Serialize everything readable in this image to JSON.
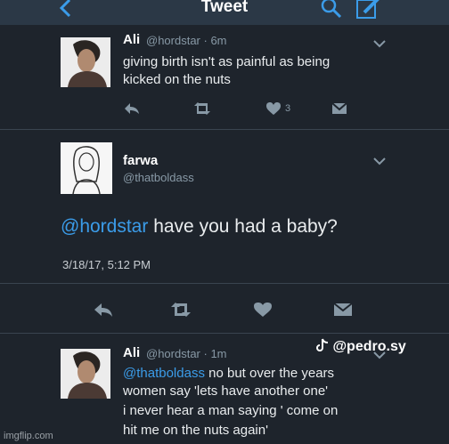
{
  "header": {
    "title": "Tweet"
  },
  "tweets": [
    {
      "name": "Ali",
      "meta": "@hordstar · 6m",
      "line1": "giving birth isn't as painful as being",
      "line2": "kicked on the nuts",
      "like_count": "3"
    },
    {
      "name": "farwa",
      "handle": "@thatboldass",
      "mention": "@hordstar",
      "text": " have you had a baby?",
      "timestamp": "3/18/17, 5:12 PM"
    },
    {
      "name": "Ali",
      "meta": "@hordstar · 1m",
      "mention": "@thatboldass",
      "line1": " no but over the years",
      "line2": "women say 'lets have another one'",
      "line3": "i never hear a man saying ' come on",
      "line4": "hit me on the nuts again'"
    }
  ],
  "watermark": {
    "handle": "@pedro.sy"
  },
  "footer": {
    "site": "imgflip.com"
  },
  "colors": {
    "accent": "#3b9ce9",
    "background": "#1e242c",
    "header": "#2b3846"
  },
  "icons": [
    "back-chevron-icon",
    "search-icon",
    "compose-icon",
    "reply-icon",
    "retweet-icon",
    "like-icon",
    "direct-message-icon",
    "chevron-down-icon",
    "tiktok-icon"
  ]
}
